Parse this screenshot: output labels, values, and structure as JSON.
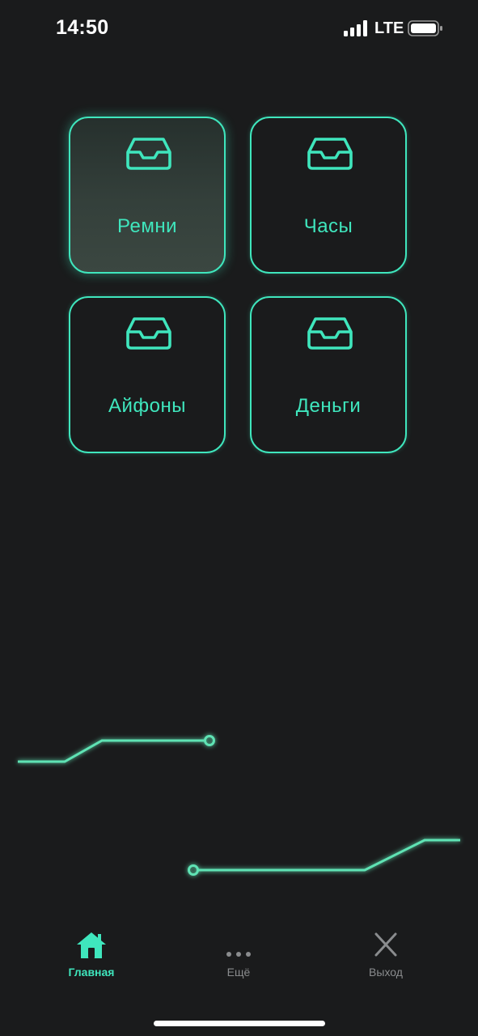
{
  "status_bar": {
    "time": "14:50",
    "network": "LTE",
    "signal_icon": "signal-bars-icon",
    "battery_icon": "battery-icon"
  },
  "tiles": [
    {
      "label": "Ремни",
      "icon": "inbox-tray-icon",
      "selected": true
    },
    {
      "label": "Часы",
      "icon": "inbox-tray-icon",
      "selected": false
    },
    {
      "label": "Айфоны",
      "icon": "inbox-tray-icon",
      "selected": false
    },
    {
      "label": "Деньги",
      "icon": "inbox-tray-icon",
      "selected": false
    }
  ],
  "tab_bar": {
    "items": [
      {
        "label": "Главная",
        "icon": "home-icon",
        "active": true
      },
      {
        "label": "Ещё",
        "icon": "more-dots-icon",
        "active": false
      },
      {
        "label": "Выход",
        "icon": "close-icon",
        "active": false
      }
    ]
  },
  "colors": {
    "background": "#1a1b1c",
    "accent": "#3fe6bd",
    "inactive": "#8a8c8e"
  }
}
